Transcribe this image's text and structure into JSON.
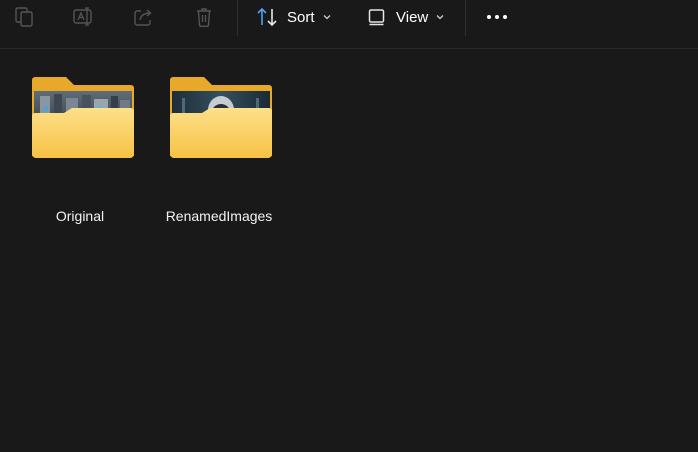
{
  "toolbar": {
    "icons": {
      "copy": "copy-icon",
      "rename": "rename-icon",
      "share": "share-icon",
      "delete": "delete-icon"
    },
    "sort_label": "Sort",
    "view_label": "View",
    "more": "more-icon"
  },
  "colors": {
    "background": "#191919",
    "folder_back": "#e8a92a",
    "folder_front": "#fccf58",
    "accent_blue": "#4ea2ee"
  },
  "folders": [
    {
      "name": "Original"
    },
    {
      "name": "RenamedImages"
    }
  ]
}
